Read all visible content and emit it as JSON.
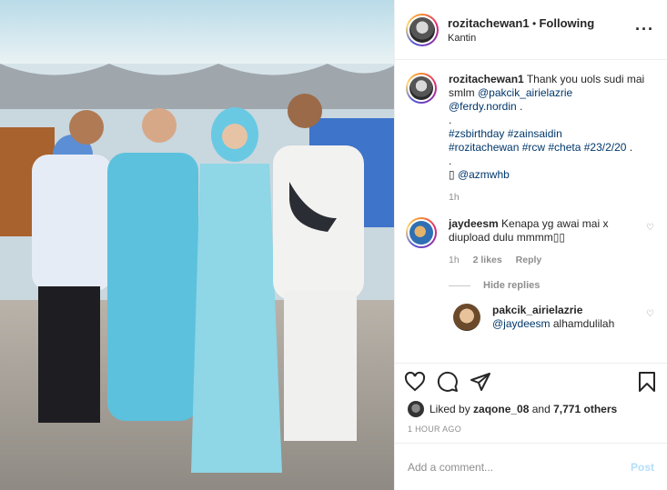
{
  "header": {
    "username": "rozitachewan1",
    "separator": "•",
    "follow_label": "Following",
    "location": "Kantin",
    "more_icon": "more-icon"
  },
  "caption": {
    "username": "rozitachewan1",
    "line1": "Thank you uols sudi mai smlm ",
    "mention1": "@pakcik_airielazrie",
    "mention2": "@ferdy.nordin",
    "after_mention2": " .",
    "dot1": ".",
    "hashtags1": "#zsbirthday #zainsaidin",
    "hashtags2": "#rozitachewan #rcw #cheta #23/2/20",
    "hashtags2_tail": " .",
    "dot2": ".",
    "camera_glyph": "▯",
    "credit": "@azmwhb",
    "time": "1h"
  },
  "comment1": {
    "username": "jaydeesm",
    "text": "Kenapa yg awai mai x diupload dulu mmmm▯▯",
    "time": "1h",
    "likes": "2 likes",
    "reply_label": "Reply",
    "hide_replies": "Hide replies"
  },
  "reply1": {
    "username": "pakcik_airielazrie",
    "mention": "@jaydeesm",
    "text": " alhamdulilah"
  },
  "likes": {
    "prefix": "Liked by ",
    "user": "zaqone_08",
    "middle": " and ",
    "count": "7,771 others"
  },
  "timestamp": "1 HOUR AGO",
  "add_comment": {
    "placeholder": "Add a comment...",
    "post_label": "Post"
  },
  "colors": {
    "link": "#00376b",
    "muted": "#8e8e8e",
    "post_disabled": "#b2dffc"
  }
}
